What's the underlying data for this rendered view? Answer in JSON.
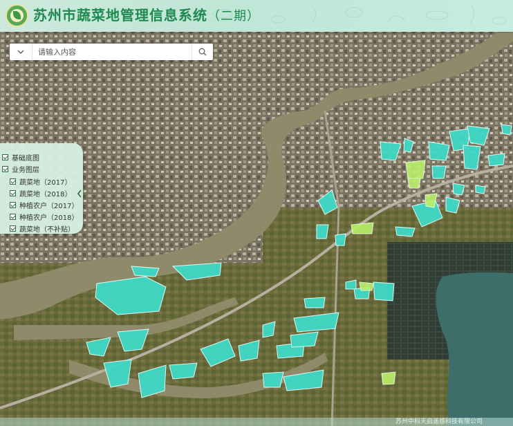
{
  "header": {
    "title": "苏州市蔬菜地管理信息系统",
    "subtitle": "（二期）"
  },
  "search": {
    "placeholder": "请输入内容",
    "dropdown_icon": "chevron-down-icon",
    "search_icon": "search-icon"
  },
  "layers": {
    "groups": [
      {
        "label": "基础底图",
        "checked": true
      },
      {
        "label": "业务图层",
        "checked": true
      }
    ],
    "items": [
      {
        "label": "蔬菜地（2017）",
        "checked": true
      },
      {
        "label": "蔬菜地（2018）",
        "checked": true
      },
      {
        "label": "种植农户（2017）",
        "checked": true
      },
      {
        "label": "种植农户（2018）",
        "checked": true
      },
      {
        "label": "蔬菜地（不补贴）",
        "checked": true
      }
    ],
    "collapse_icon": "chevron-left-icon"
  },
  "footer": {
    "copyright": "苏州中科天启遥感科技有限公司"
  },
  "colors": {
    "title": "#1f8a4f",
    "header_bg": "#c6ece2",
    "vegetable_plot": "#3fd9c6",
    "vegetable_plot_nosubsidy": "#b9f06a",
    "water": "#8f8a6a",
    "lake": "#3e6e6a"
  }
}
